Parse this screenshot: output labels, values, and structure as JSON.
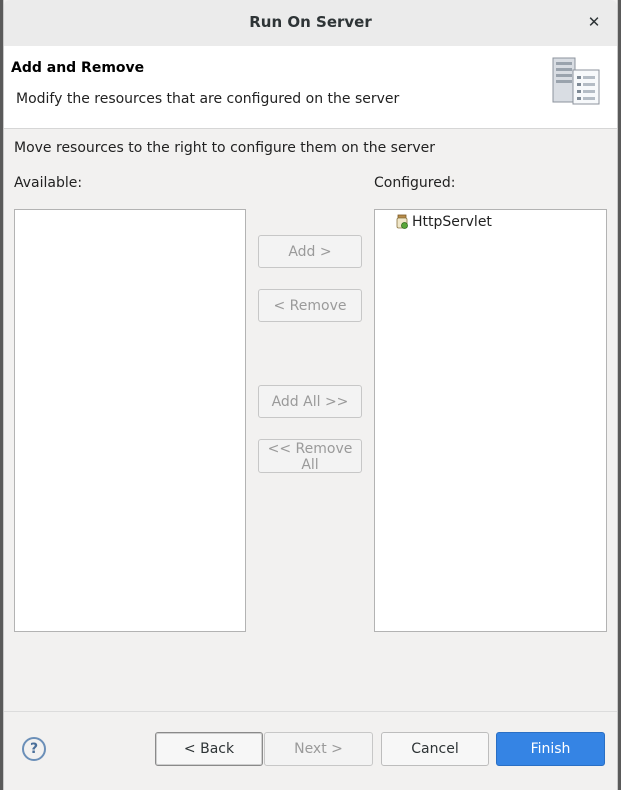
{
  "window": {
    "title": "Run On Server"
  },
  "banner": {
    "heading": "Add and Remove",
    "description": "Modify the resources that are configured on the server"
  },
  "instructions": "Move resources to the right to configure them on the server",
  "available": {
    "label": "Available:",
    "items": []
  },
  "configured": {
    "label": "Configured:",
    "items": [
      {
        "label": "HttpServlet"
      }
    ]
  },
  "middle_buttons": {
    "add": "Add >",
    "remove": "< Remove",
    "add_all": "Add All >>",
    "remove_all": "<< Remove All"
  },
  "footer": {
    "back": "< Back",
    "next": "Next >",
    "cancel": "Cancel",
    "finish": "Finish"
  },
  "colors": {
    "accent": "#3584e4",
    "disabled_text": "#9a9a9a"
  }
}
